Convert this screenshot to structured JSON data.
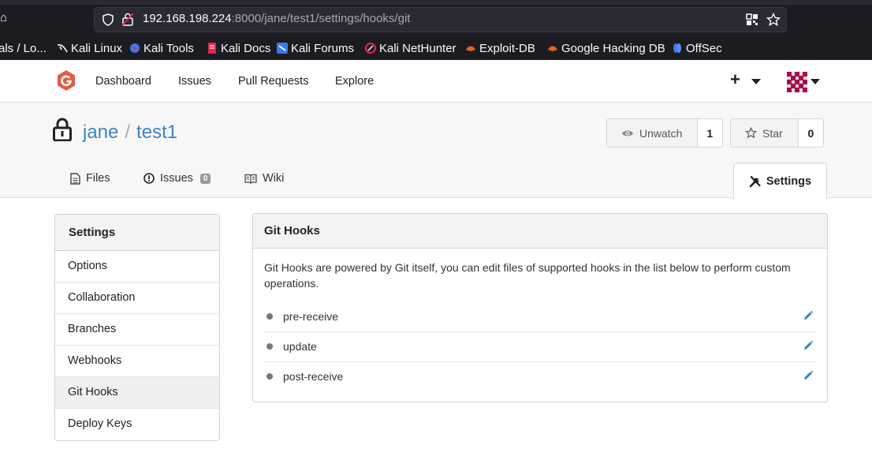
{
  "browser": {
    "home_fragment": "ɑ",
    "url_host": "192.168.198.224",
    "url_rest": ":8000/jane/test1/settings/hooks/git",
    "bookmarks": [
      {
        "label": "als / Lo...",
        "icon": "none"
      },
      {
        "label": "Kali Linux",
        "icon": "kali-dragon-icon"
      },
      {
        "label": "Kali Tools",
        "icon": "kali-tools-icon"
      },
      {
        "label": "Kali Docs",
        "icon": "kali-docs-icon"
      },
      {
        "label": "Kali Forums",
        "icon": "kali-forums-icon"
      },
      {
        "label": "Kali NetHunter",
        "icon": "nethunter-icon"
      },
      {
        "label": "Exploit-DB",
        "icon": "exploit-db-icon"
      },
      {
        "label": "Google Hacking DB",
        "icon": "ghdb-icon"
      },
      {
        "label": "OffSec",
        "icon": "offsec-icon"
      }
    ]
  },
  "header": {
    "nav": [
      "Dashboard",
      "Issues",
      "Pull Requests",
      "Explore"
    ],
    "plus": "+"
  },
  "repo": {
    "owner": "jane",
    "separator": "/",
    "name": "test1",
    "watch_label": "Unwatch",
    "watch_count": "1",
    "star_label": "Star",
    "star_count": "0",
    "tabs": {
      "files": "Files",
      "issues": "Issues",
      "issues_count": "0",
      "wiki": "Wiki",
      "settings": "Settings"
    }
  },
  "sidebar": {
    "title": "Settings",
    "items": [
      "Options",
      "Collaboration",
      "Branches",
      "Webhooks",
      "Git Hooks",
      "Deploy Keys"
    ],
    "active": "Git Hooks"
  },
  "main": {
    "title": "Git Hooks",
    "description": "Git Hooks are powered by Git itself, you can edit files of supported hooks in the list below to perform custom operations.",
    "hooks": [
      "pre-receive",
      "update",
      "post-receive"
    ]
  },
  "colors": {
    "link": "#4183c4",
    "gitea_orange": "#e05d44",
    "edit_icon": "#4183c4"
  }
}
